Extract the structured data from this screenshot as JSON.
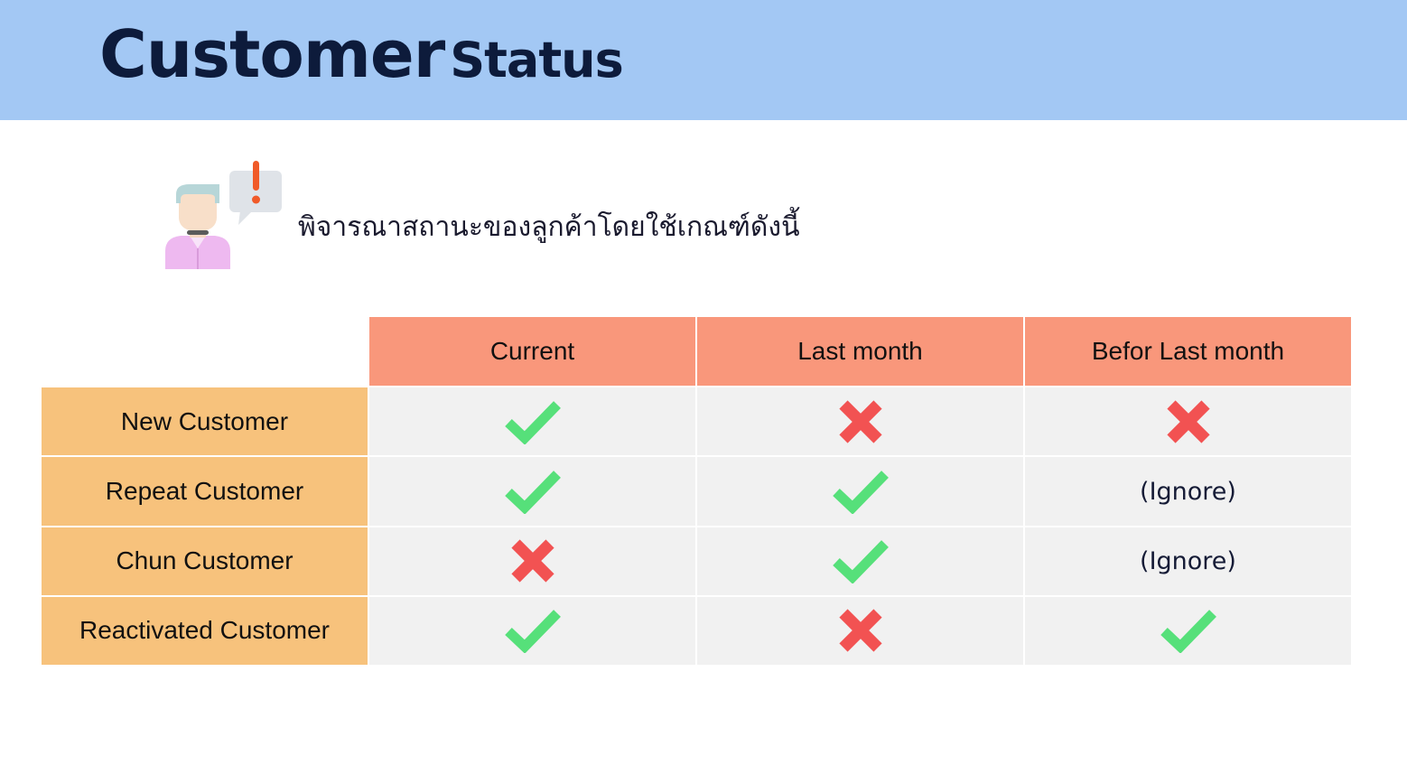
{
  "header": {
    "title_main": "Customer",
    "title_sub": "Status",
    "band_color": "#a3c8f4"
  },
  "intro": {
    "icon": "person-alert-icon",
    "text": "พิจารณาสถานะของลูกค้าโดยใช้เกณฑ์ดังนี้"
  },
  "table": {
    "columns": [
      "Current",
      "Last month",
      "Befor Last month"
    ],
    "rows": [
      {
        "label": "New Customer",
        "cells": [
          "check",
          "cross",
          "cross"
        ]
      },
      {
        "label": "Repeat Customer",
        "cells": [
          "check",
          "check",
          "ignore"
        ]
      },
      {
        "label": "Chun Customer",
        "cells": [
          "cross",
          "check",
          "ignore"
        ]
      },
      {
        "label": "Reactivated Customer",
        "cells": [
          "check",
          "cross",
          "check"
        ]
      }
    ],
    "ignore_label": "(Ignore)",
    "colors": {
      "column_header": "#f9977b",
      "row_header": "#f7c27c",
      "cell": "#f1f1f1",
      "check": "#56e07a",
      "cross": "#f25252"
    }
  }
}
